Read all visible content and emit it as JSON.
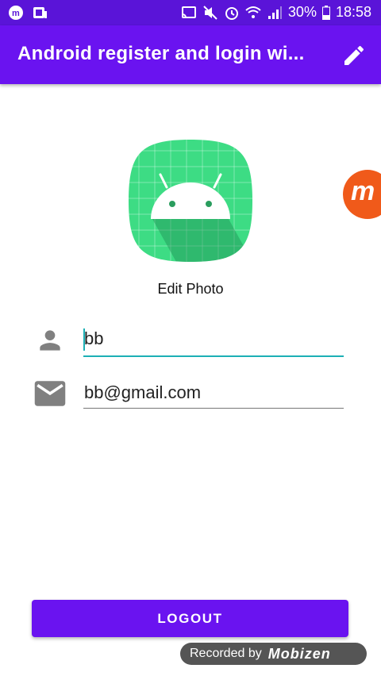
{
  "status_bar": {
    "battery": "30%",
    "time": "18:58"
  },
  "app_bar": {
    "title": "Android register and login wi..."
  },
  "profile": {
    "edit_photo_label": "Edit Photo",
    "name_value": "bb",
    "email_value": "bb@gmail.com"
  },
  "actions": {
    "logout_label": "LOGOUT"
  },
  "overlay": {
    "recorder_bubble_letter": "m",
    "watermark_text": "Recorded by",
    "watermark_logo": "Mobizen"
  },
  "colors": {
    "status_bar_bg": "#5a14d8",
    "primary": "#6a13f0",
    "accent": "#1cb0b5",
    "avatar_green": "#3ddc84",
    "recorder_orange": "#f05a1a"
  },
  "icons": [
    "edit-icon",
    "person-icon",
    "mail-icon",
    "cast-icon",
    "mute-icon",
    "alarm-icon",
    "wifi-icon",
    "signal-icon",
    "battery-icon"
  ]
}
